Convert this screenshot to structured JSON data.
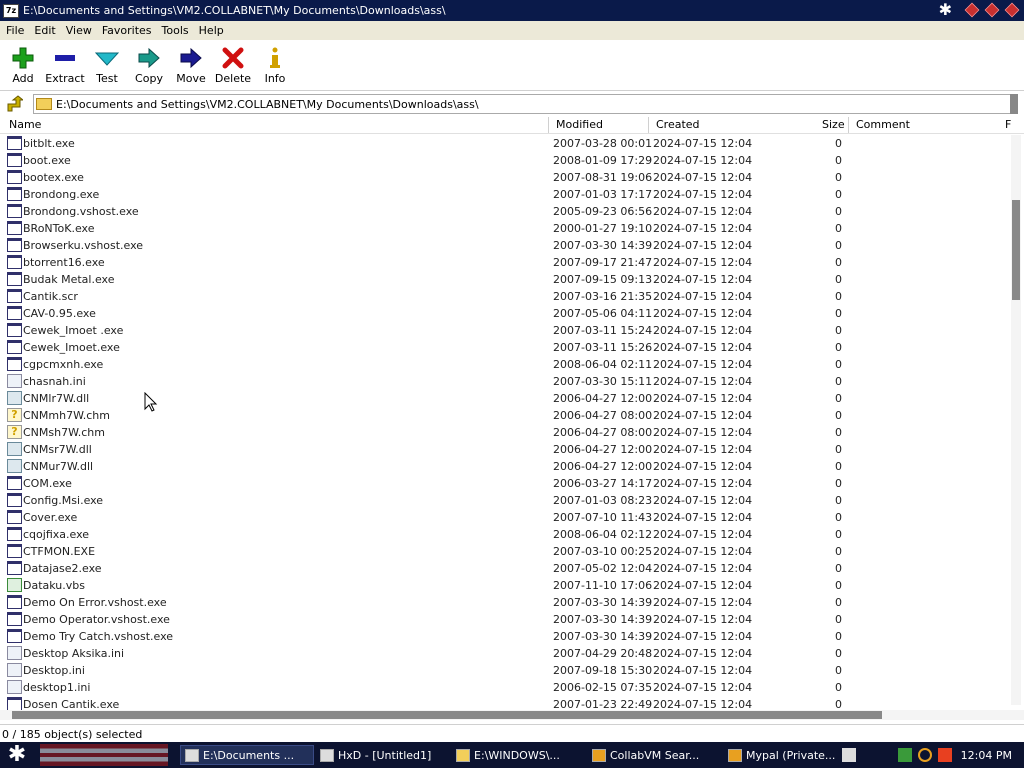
{
  "window": {
    "app_icon_text": "7z",
    "title": "E:\\Documents and Settings\\VM2.COLLABNET\\My Documents\\Downloads\\ass\\"
  },
  "menu": [
    "File",
    "Edit",
    "View",
    "Favorites",
    "Tools",
    "Help"
  ],
  "toolbar": [
    {
      "label": "Add",
      "icon": "add-icon",
      "color": "#1ca01c"
    },
    {
      "label": "Extract",
      "icon": "extract-icon",
      "color": "#1e1ea8"
    },
    {
      "label": "Test",
      "icon": "test-icon",
      "color": "#22b8c8"
    },
    {
      "label": "Copy",
      "icon": "copy-icon",
      "color": "#1a9a8a"
    },
    {
      "label": "Move",
      "icon": "move-icon",
      "color": "#1a1a90"
    },
    {
      "label": "Delete",
      "icon": "delete-icon",
      "color": "#d01010"
    },
    {
      "label": "Info",
      "icon": "info-icon",
      "color": "#d0a000"
    }
  ],
  "address": {
    "path": "E:\\Documents and Settings\\VM2.COLLABNET\\My Documents\\Downloads\\ass\\"
  },
  "columns": {
    "name": "Name",
    "modified": "Modified",
    "created": "Created",
    "size": "Size",
    "comment": "Comment",
    "extra": "F"
  },
  "files": [
    {
      "name": "bitblt.exe",
      "modified": "2007-03-28 00:01",
      "created": "2024-07-15 12:04",
      "size": "0",
      "type": "exe"
    },
    {
      "name": "boot.exe",
      "modified": "2008-01-09 17:29",
      "created": "2024-07-15 12:04",
      "size": "0",
      "type": "exe"
    },
    {
      "name": "bootex.exe",
      "modified": "2007-08-31 19:06",
      "created": "2024-07-15 12:04",
      "size": "0",
      "type": "exe"
    },
    {
      "name": "Brondong.exe",
      "modified": "2007-01-03 17:17",
      "created": "2024-07-15 12:04",
      "size": "0",
      "type": "exe"
    },
    {
      "name": "Brondong.vshost.exe",
      "modified": "2005-09-23 06:56",
      "created": "2024-07-15 12:04",
      "size": "0",
      "type": "exe"
    },
    {
      "name": "BRoNToK.exe",
      "modified": "2000-01-27 19:10",
      "created": "2024-07-15 12:04",
      "size": "0",
      "type": "exe"
    },
    {
      "name": "Browserku.vshost.exe",
      "modified": "2007-03-30 14:39",
      "created": "2024-07-15 12:04",
      "size": "0",
      "type": "exe"
    },
    {
      "name": "btorrent16.exe",
      "modified": "2007-09-17 21:47",
      "created": "2024-07-15 12:04",
      "size": "0",
      "type": "exe"
    },
    {
      "name": "Budak Metal.exe",
      "modified": "2007-09-15 09:13",
      "created": "2024-07-15 12:04",
      "size": "0",
      "type": "exe"
    },
    {
      "name": "Cantik.scr",
      "modified": "2007-03-16 21:35",
      "created": "2024-07-15 12:04",
      "size": "0",
      "type": "exe"
    },
    {
      "name": "CAV-0.95.exe",
      "modified": "2007-05-06 04:11",
      "created": "2024-07-15 12:04",
      "size": "0",
      "type": "exe"
    },
    {
      "name": "Cewek_Imoet .exe",
      "modified": "2007-03-11 15:24",
      "created": "2024-07-15 12:04",
      "size": "0",
      "type": "exe"
    },
    {
      "name": "Cewek_Imoet.exe",
      "modified": "2007-03-11 15:26",
      "created": "2024-07-15 12:04",
      "size": "0",
      "type": "exe"
    },
    {
      "name": "cgpcmxnh.exe",
      "modified": "2008-06-04 02:11",
      "created": "2024-07-15 12:04",
      "size": "0",
      "type": "exe"
    },
    {
      "name": "chasnah.ini",
      "modified": "2007-03-30 15:11",
      "created": "2024-07-15 12:04",
      "size": "0",
      "type": "ini"
    },
    {
      "name": "CNMlr7W.dll",
      "modified": "2006-04-27 12:00",
      "created": "2024-07-15 12:04",
      "size": "0",
      "type": "dll"
    },
    {
      "name": "CNMmh7W.chm",
      "modified": "2006-04-27 08:00",
      "created": "2024-07-15 12:04",
      "size": "0",
      "type": "chm"
    },
    {
      "name": "CNMsh7W.chm",
      "modified": "2006-04-27 08:00",
      "created": "2024-07-15 12:04",
      "size": "0",
      "type": "chm"
    },
    {
      "name": "CNMsr7W.dll",
      "modified": "2006-04-27 12:00",
      "created": "2024-07-15 12:04",
      "size": "0",
      "type": "dll"
    },
    {
      "name": "CNMur7W.dll",
      "modified": "2006-04-27 12:00",
      "created": "2024-07-15 12:04",
      "size": "0",
      "type": "dll"
    },
    {
      "name": "COM.exe",
      "modified": "2006-03-27 14:17",
      "created": "2024-07-15 12:04",
      "size": "0",
      "type": "exe"
    },
    {
      "name": "Config.Msi.exe",
      "modified": "2007-01-03 08:23",
      "created": "2024-07-15 12:04",
      "size": "0",
      "type": "exe"
    },
    {
      "name": "Cover.exe",
      "modified": "2007-07-10 11:43",
      "created": "2024-07-15 12:04",
      "size": "0",
      "type": "exe"
    },
    {
      "name": "cqojfixa.exe",
      "modified": "2008-06-04 02:12",
      "created": "2024-07-15 12:04",
      "size": "0",
      "type": "exe"
    },
    {
      "name": "CTFMON.EXE",
      "modified": "2007-03-10 00:25",
      "created": "2024-07-15 12:04",
      "size": "0",
      "type": "exe"
    },
    {
      "name": "Datajase2.exe",
      "modified": "2007-05-02 12:04",
      "created": "2024-07-15 12:04",
      "size": "0",
      "type": "exe"
    },
    {
      "name": "Dataku.vbs",
      "modified": "2007-11-10 17:06",
      "created": "2024-07-15 12:04",
      "size": "0",
      "type": "vbs"
    },
    {
      "name": "Demo On Error.vshost.exe",
      "modified": "2007-03-30 14:39",
      "created": "2024-07-15 12:04",
      "size": "0",
      "type": "exe"
    },
    {
      "name": "Demo Operator.vshost.exe",
      "modified": "2007-03-30 14:39",
      "created": "2024-07-15 12:04",
      "size": "0",
      "type": "exe"
    },
    {
      "name": "Demo Try Catch.vshost.exe",
      "modified": "2007-03-30 14:39",
      "created": "2024-07-15 12:04",
      "size": "0",
      "type": "exe"
    },
    {
      "name": "Desktop Aksika.ini",
      "modified": "2007-04-29 20:48",
      "created": "2024-07-15 12:04",
      "size": "0",
      "type": "ini"
    },
    {
      "name": "Desktop.ini",
      "modified": "2007-09-18 15:30",
      "created": "2024-07-15 12:04",
      "size": "0",
      "type": "ini"
    },
    {
      "name": "desktop1.ini",
      "modified": "2006-02-15 07:35",
      "created": "2024-07-15 12:04",
      "size": "0",
      "type": "ini"
    },
    {
      "name": "Dosen Cantik.exe",
      "modified": "2007-01-23 22:49",
      "created": "2024-07-15 12:04",
      "size": "0",
      "type": "exe"
    }
  ],
  "status": {
    "text": "0 / 185 object(s) selected"
  },
  "taskbar": {
    "tasks": [
      {
        "label": "E:\\Documents ...",
        "active": true
      },
      {
        "label": "HxD - [Untitled1]",
        "active": false
      },
      {
        "label": "E:\\WINDOWS\\...",
        "active": false
      },
      {
        "label": "CollabVM Sear...",
        "active": false
      },
      {
        "label": "Mypal (Private...",
        "active": false
      }
    ],
    "clock": "12:04 PM"
  }
}
